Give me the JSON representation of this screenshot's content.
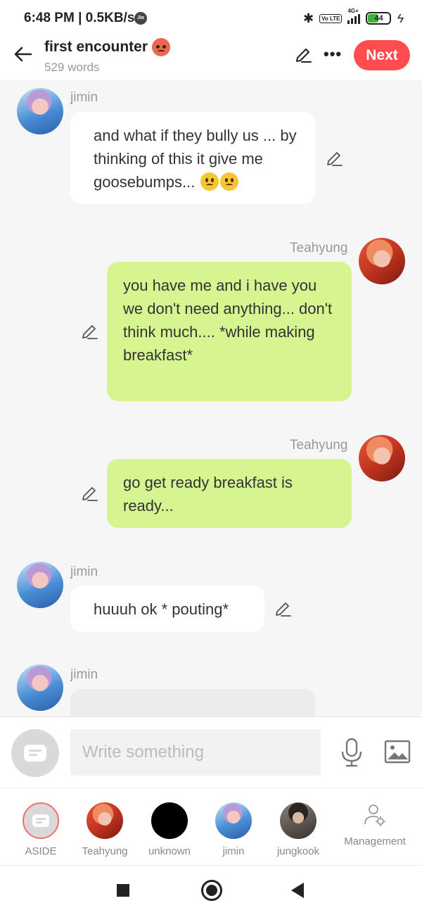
{
  "status_bar": {
    "time_speed": "6:48 PM | 0.5KB/s",
    "carrier_badge": "Jio",
    "volte": "Vo LTE",
    "network": "4G+",
    "battery": "44"
  },
  "header": {
    "title": "first encounter",
    "title_emoji": "angry-face",
    "word_count": "529 words",
    "next_label": "Next"
  },
  "messages": [
    {
      "speaker": "jimin",
      "side": "left",
      "text": "and what if they bully us ... by thinking of this it give me goosebumps...",
      "emojis": 2
    },
    {
      "speaker": "Teahyung",
      "side": "right",
      "text": "you have me and i have you we don't need anything... don't think much.... *while making breakfast*"
    },
    {
      "speaker": "Teahyung",
      "side": "right",
      "text": "go get ready breakfast is ready..."
    },
    {
      "speaker": "jimin",
      "side": "left",
      "text": "huuuh ok * pouting*"
    },
    {
      "speaker": "jimin",
      "side": "left",
      "text": ""
    }
  ],
  "composer": {
    "placeholder": "Write something"
  },
  "roles": [
    {
      "label": "ASIDE"
    },
    {
      "label": "Teahyung"
    },
    {
      "label": "unknown"
    },
    {
      "label": "jimin"
    },
    {
      "label": "jungkook"
    }
  ],
  "management_label": "Management",
  "colors": {
    "accent": "#ff4d4f",
    "bubble_green": "#d6f590",
    "bubble_white": "#ffffff"
  }
}
